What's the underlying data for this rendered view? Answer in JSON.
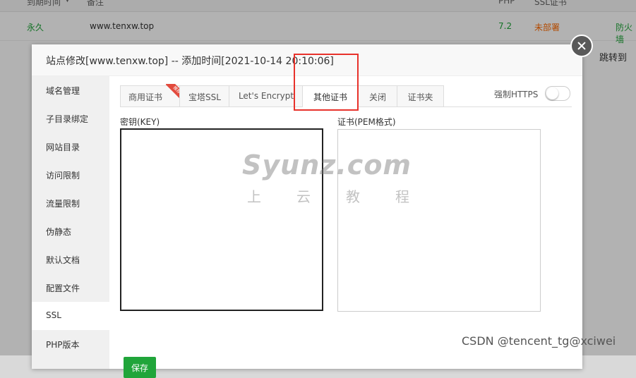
{
  "background": {
    "header": {
      "expire_col": "到期时间",
      "remark_col": "备注",
      "php_col": "PHP",
      "ssl_col": "SSL证书"
    },
    "row": {
      "expire": "永久",
      "remark": "www.tenxw.top",
      "php": "7.2",
      "ssl": "未部署",
      "firewall": "防火墙"
    },
    "jump_label": "跳转到"
  },
  "dialog": {
    "title": "站点修改[www.tenxw.top] -- 添加时间[2021-10-14 20:10:06]",
    "sidebar": [
      {
        "label": "域名管理"
      },
      {
        "label": "子目录绑定"
      },
      {
        "label": "网站目录"
      },
      {
        "label": "访问限制"
      },
      {
        "label": "流量限制"
      },
      {
        "label": "伪静态"
      },
      {
        "label": "默认文档"
      },
      {
        "label": "配置文件"
      },
      {
        "label": "SSL"
      },
      {
        "label": "PHP版本"
      }
    ],
    "active_sidebar": "SSL",
    "tabs": [
      {
        "label": "商用证书",
        "badge": "推荐"
      },
      {
        "label": "宝塔SSL"
      },
      {
        "label": "Let's Encrypt"
      },
      {
        "label": "其他证书"
      },
      {
        "label": "关闭"
      },
      {
        "label": "证书夹"
      }
    ],
    "active_tab": "其他证书",
    "force_https_label": "强制HTTPS",
    "force_https_on": false,
    "key_label": "密钥(KEY)",
    "key_value": "",
    "cert_label": "证书(PEM格式)",
    "cert_value": "",
    "save_label": "保存"
  },
  "watermark": {
    "main": "Syunz.com",
    "sub": "上云教程"
  },
  "csdn_credit": "CSDN @tencent_tg@xciwei",
  "colors": {
    "primary_green": "#20a53a",
    "php_green": "#20a53a",
    "ssl_orange": "#ff6a00",
    "highlight_red": "#e8322b",
    "ribbon_red": "#e24a3d"
  }
}
